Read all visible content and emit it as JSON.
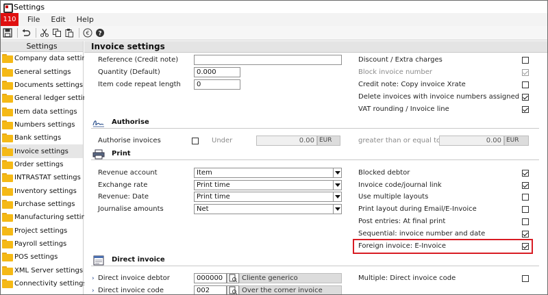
{
  "window": {
    "title": "Settings"
  },
  "menubar": {
    "company": "110",
    "items": [
      "File",
      "Edit",
      "Help"
    ]
  },
  "toolbar": {
    "icons": [
      "save-icon",
      "undo-icon",
      "cut-icon",
      "copy-icon",
      "paste-icon",
      "euro-icon",
      "help-icon"
    ]
  },
  "sidebar": {
    "header": "Settings",
    "items": [
      "Company data settings",
      "General settings",
      "Documents settings",
      "General ledger settings",
      "Item data settings",
      "Numbers settings",
      "Bank settings",
      "Invoice settings",
      "Order settings",
      "INTRASTAT settings",
      "Inventory settings",
      "Purchase settings",
      "Manufacturing settings",
      "Project settings",
      "Payroll settings",
      "POS settings",
      "XML Server settings",
      "Connectivity settings"
    ],
    "selected": "Invoice settings"
  },
  "main": {
    "title": "Invoice settings",
    "general": {
      "reference_label": "Reference (Credit note)",
      "reference_value": "",
      "quantity_label": "Quantity (Default)",
      "quantity_value": "0.000",
      "repeat_label": "Item code repeat length",
      "repeat_value": "0"
    },
    "right_options": [
      {
        "label": "Discount / Extra charges",
        "checked": false,
        "disabled": false
      },
      {
        "label": "Block invoice number",
        "checked": true,
        "disabled": true
      },
      {
        "label": "Credit note: Copy invoice Xrate",
        "checked": false,
        "disabled": false
      },
      {
        "label": "Delete invoices with invoice numbers assigned",
        "checked": true,
        "disabled": false
      },
      {
        "label": "VAT rounding / Invoice line",
        "checked": true,
        "disabled": false
      }
    ],
    "authorise": {
      "title": "Authorise",
      "invoices_label": "Authorise invoices",
      "invoices_checked": false,
      "under_label": "Under",
      "under_value": "0.00",
      "under_currency": "EUR",
      "gte_label": "greater than or equal to",
      "gte_value": "0.00",
      "gte_currency": "EUR"
    },
    "print": {
      "title": "Print",
      "fields": [
        {
          "label": "Revenue account",
          "value": "Item"
        },
        {
          "label": "Exchange rate",
          "value": "Print time"
        },
        {
          "label": "Revenue: Date",
          "value": "Print time"
        },
        {
          "label": "Journalise amounts",
          "value": "Net"
        }
      ],
      "options": [
        {
          "label": "Blocked debtor",
          "checked": true
        },
        {
          "label": "Invoice code/journal link",
          "checked": true
        },
        {
          "label": "Use multiple layouts",
          "checked": false
        },
        {
          "label": "Print layout during Email/E-Invoice",
          "checked": false
        },
        {
          "label": "Post entries: At final print",
          "checked": false
        },
        {
          "label": "Sequential: invoice number and date",
          "checked": true
        },
        {
          "label": "Foreign invoice: E-Invoice",
          "checked": true
        }
      ]
    },
    "direct": {
      "title": "Direct invoice",
      "debtor_label": "Direct invoice debtor",
      "debtor_code": "000000",
      "debtor_name": "Cliente generico",
      "code_label": "Direct invoice code",
      "code_value": "002",
      "code_name": "Over the corner invoice",
      "multiple_label": "Multiple: Direct invoice code",
      "multiple_checked": false
    }
  },
  "colors": {
    "highlight": "#d81b23",
    "company_badge": "#e01010",
    "folder": "#f5b916"
  }
}
